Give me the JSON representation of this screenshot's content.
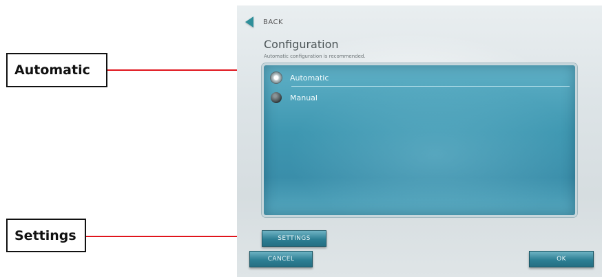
{
  "annotations": {
    "automatic_callout": "Automatic",
    "settings_callout": "Settings"
  },
  "colors": {
    "arrow": "#e0141c",
    "accent": "#2f8f9a",
    "panel": "#3e97b1"
  },
  "screen": {
    "back_label": "BACK",
    "title": "Configuration",
    "subtitle": "Automatic configuration is recommended.",
    "options": [
      {
        "label": "Automatic",
        "selected": true
      },
      {
        "label": "Manual",
        "selected": false
      }
    ],
    "settings_label": "SETTINGS",
    "cancel_label": "CANCEL",
    "ok_label": "OK"
  },
  "icons": {
    "back": "back-arrow-icon",
    "radio_selected": "radio-selected-icon",
    "radio_unselected": "radio-unselected-icon"
  }
}
